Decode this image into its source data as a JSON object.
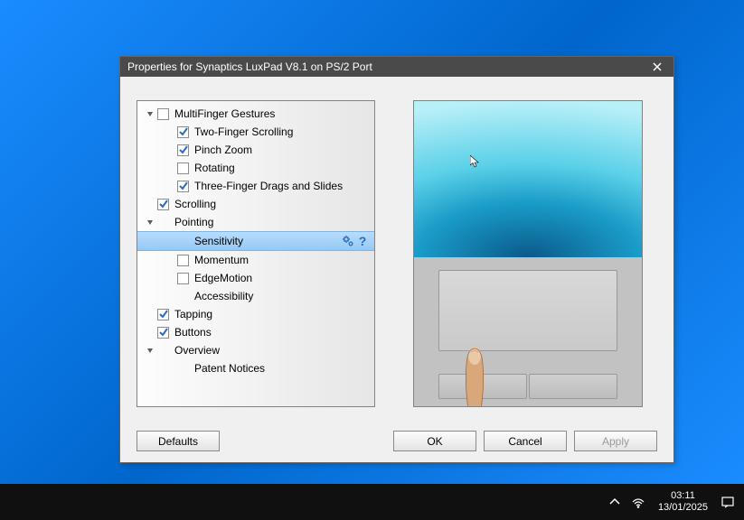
{
  "window": {
    "title": "Properties for Synaptics LuxPad V8.1 on PS/2 Port"
  },
  "tree": {
    "multifinger": "MultiFinger Gestures",
    "twofinger": "Two-Finger Scrolling",
    "pinch": "Pinch Zoom",
    "rotating": "Rotating",
    "threefinger": "Three-Finger Drags and Slides",
    "scrolling": "Scrolling",
    "pointing": "Pointing",
    "sensitivity": "Sensitivity",
    "momentum": "Momentum",
    "edgemotion": "EdgeMotion",
    "accessibility": "Accessibility",
    "tapping": "Tapping",
    "buttons": "Buttons",
    "overview": "Overview",
    "patent": "Patent Notices"
  },
  "buttons": {
    "defaults": "Defaults",
    "ok": "OK",
    "cancel": "Cancel",
    "apply": "Apply"
  },
  "taskbar": {
    "time": "03:11",
    "date": "13/01/2025"
  }
}
